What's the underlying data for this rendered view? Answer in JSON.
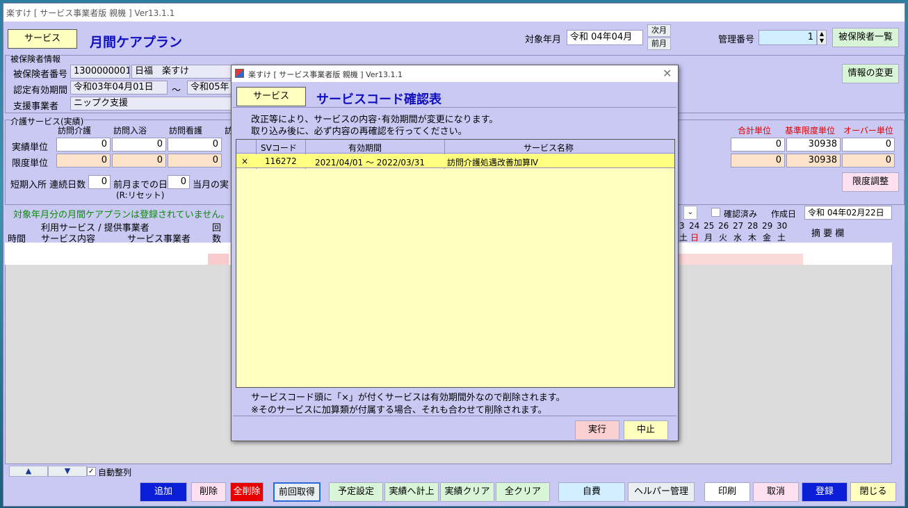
{
  "window": {
    "title": "楽すけ [ サービス事業者版 親機 ] Ver13.1.1"
  },
  "header": {
    "mode_button": "サービス",
    "page_title": "月間ケアプラン",
    "target_month_label": "対象年月",
    "target_month_value": "令和 04年04月",
    "next_month": "次月",
    "prev_month": "前月",
    "mgmt_label": "管理番号",
    "mgmt_value": "1",
    "insured_list_button": "被保険者一覧"
  },
  "insured": {
    "section_label": "被保険者情報",
    "number_label": "被保険者番号",
    "number_value": "1300000001",
    "name_value": "日福　楽すけ",
    "period_label": "認定有効期間",
    "period_from": "令和03年04月01日",
    "tilde": "～",
    "period_to": "令和05年",
    "support_label": "支援事業者",
    "support_value": "ニップク支援",
    "change_button": "情報の変更"
  },
  "care": {
    "section_label": "介護サービス(実績)",
    "cols": [
      "訪問介護",
      "訪問入浴",
      "訪問看護",
      "訪"
    ],
    "actual_label": "実績単位",
    "actual_values": [
      "0",
      "0",
      "0"
    ],
    "limit_label": "限度単位",
    "limit_values": [
      "0",
      "0",
      "0"
    ],
    "short_label": "短期入所 連続日数",
    "short_value": "0",
    "prev_days_label": "前月までの日",
    "prev_days_value": "0",
    "month_label": "当月の実",
    "reset_note": "(R:リセット)",
    "sum_label": "合計単位",
    "base_label": "基準限度単位",
    "over_label": "オーバー単位",
    "actual_sum": "0",
    "actual_base": "30938",
    "actual_over": "0",
    "limit_sum": "0",
    "limit_base": "30938",
    "limit_over": "0",
    "adjust_button": "限度調整"
  },
  "plan": {
    "notice": "対象年月分の月間ケアプランは登録されていません。",
    "confirmed_label": "確認済み",
    "created_label": "作成日",
    "created_value": "令和 04年02月22日",
    "hdr_service": "利用サービス / 提供事業者",
    "hdr_time": "時間",
    "hdr_content": "サービス内容",
    "hdr_provider": "サービス事業者",
    "hdr_count1": "回",
    "hdr_count2": "数",
    "days": [
      "3",
      "24",
      "25",
      "26",
      "27",
      "28",
      "29",
      "30"
    ],
    "weekdays": [
      "土",
      "日",
      "月",
      "火",
      "水",
      "木",
      "金",
      "土"
    ],
    "memo_label": "摘 要 欄",
    "auto_sort": "自動整列"
  },
  "footer": {
    "add": "追加",
    "delete": "削除",
    "delete_all": "全削除",
    "prev_get": "前回取得",
    "schedule": "予定設定",
    "to_actual": "実績へ計上",
    "clear_actual": "実績クリア",
    "clear_all": "全クリア",
    "self_pay": "自費",
    "helper": "ヘルパー管理",
    "print": "印刷",
    "cancel": "取消",
    "register": "登録",
    "close": "閉じる"
  },
  "dialog": {
    "title": "楽すけ [ サービス事業者版 親機 ] Ver13.1.1",
    "mode_button": "サービス",
    "heading": "サービスコード確認表",
    "msg1": "改正等により、サービスの内容･有効期間が変更になります。",
    "msg2": "取り込み後に、必ず内容の再確認を行ってください。",
    "cols": [
      "SVコード",
      "有効期間",
      "サービス名称"
    ],
    "rows": [
      {
        "mark": "×",
        "code": "116272",
        "period": "2021/04/01 ～ 2022/03/31",
        "name": "訪問介護処遇改善加算Ⅳ"
      }
    ],
    "note1": "サービスコード頭に「×」が付くサービスは有効期間外なので削除されます。",
    "note2": "※そのサービスに加算類が付属する場合、それも合わせて削除されます。",
    "execute": "実行",
    "abort": "中止"
  }
}
